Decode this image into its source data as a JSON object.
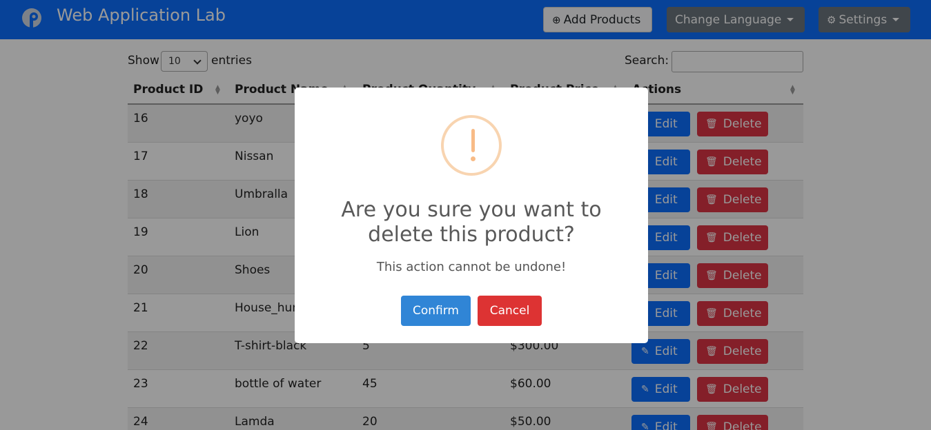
{
  "navbar": {
    "brand": "Web Application Lab",
    "add_products_label": "Add Products",
    "change_language_label": "Change Language",
    "settings_label": "Settings"
  },
  "controls": {
    "show_label": "Show",
    "entries_value": "10",
    "entries_label": "entries",
    "search_label": "Search:"
  },
  "table": {
    "columns": [
      "Product ID",
      "Product Name",
      "Product Quantity",
      "Product Price",
      "Actions"
    ],
    "edit_label": "Edit",
    "delete_label": "Delete",
    "rows": [
      {
        "id": "16",
        "name": "yoyo",
        "qty": "",
        "price": ""
      },
      {
        "id": "17",
        "name": "Nissan",
        "qty": "",
        "price": ""
      },
      {
        "id": "18",
        "name": "Umbralla",
        "qty": "",
        "price": ""
      },
      {
        "id": "19",
        "name": "Lion",
        "qty": "",
        "price": ""
      },
      {
        "id": "20",
        "name": "Shoes",
        "qty": "",
        "price": ""
      },
      {
        "id": "21",
        "name": "House_hun",
        "qty": "",
        "price": ""
      },
      {
        "id": "22",
        "name": "T-shirt-black",
        "qty": "5",
        "price": "$300.00"
      },
      {
        "id": "23",
        "name": "bottle of water",
        "qty": "45",
        "price": "$60.00"
      },
      {
        "id": "24",
        "name": "Lamda",
        "qty": "20",
        "price": "$50.00"
      }
    ]
  },
  "modal": {
    "title": "Are you sure you want to delete this product?",
    "text": "This action cannot be undone!",
    "confirm_label": "Confirm",
    "cancel_label": "Cancel"
  },
  "colors": {
    "navbar": "#0d6efd",
    "edit": "#0d6efd",
    "delete": "#dc3545",
    "confirm": "#3085d6",
    "cancel": "#dd3333",
    "warning": "#f8bb86"
  }
}
